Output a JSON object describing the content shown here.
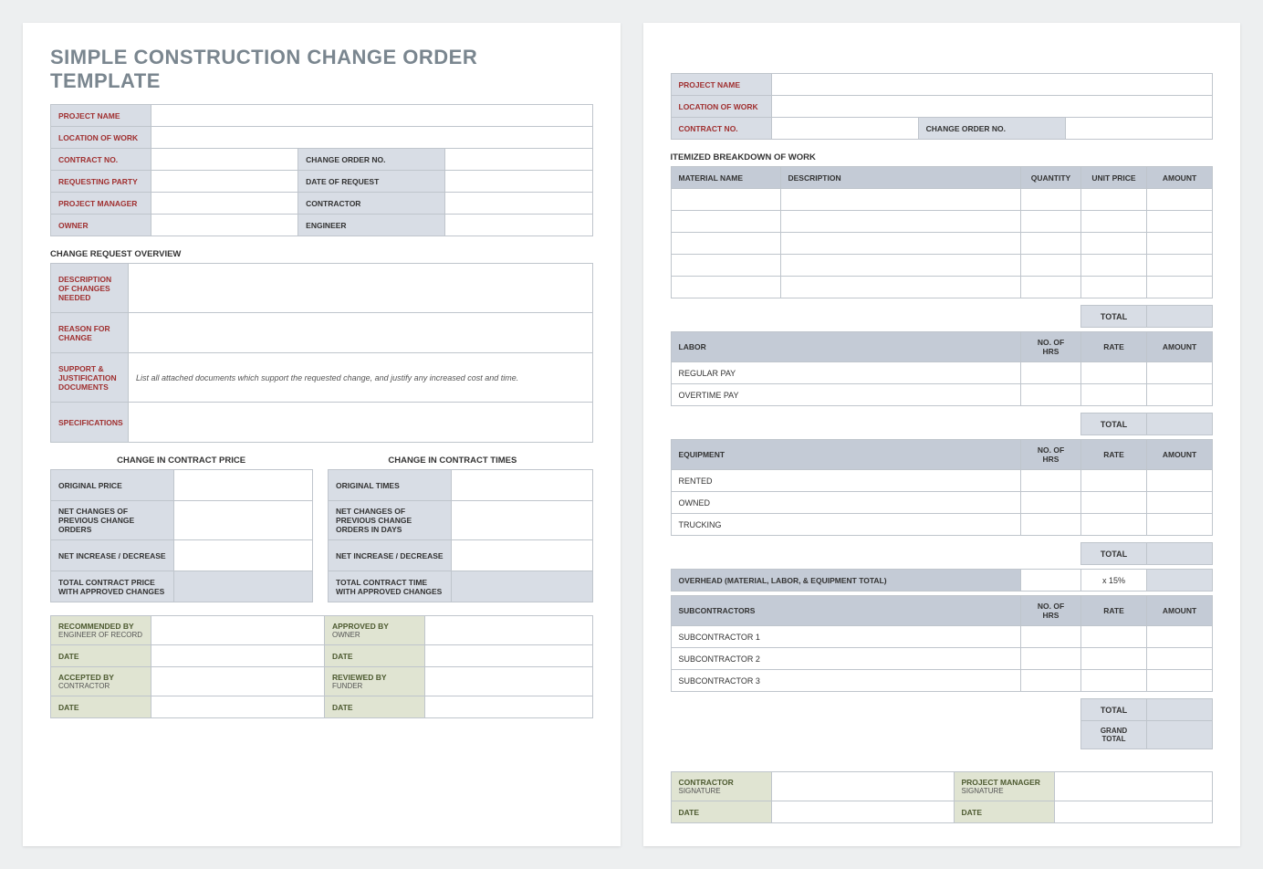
{
  "title": "SIMPLE CONSTRUCTION CHANGE ORDER TEMPLATE",
  "hdr": {
    "project_name": "PROJECT NAME",
    "location": "LOCATION OF WORK",
    "contract_no": "CONTRACT NO.",
    "change_order_no": "CHANGE ORDER NO.",
    "requesting_party": "REQUESTING PARTY",
    "date_of_request": "DATE OF REQUEST",
    "project_manager": "PROJECT MANAGER",
    "contractor": "CONTRACTOR",
    "owner": "OWNER",
    "engineer": "ENGINEER"
  },
  "overview": {
    "heading": "CHANGE REQUEST OVERVIEW",
    "desc": "DESCRIPTION OF CHANGES NEEDED",
    "reason": "REASON FOR CHANGE",
    "support": "SUPPORT & JUSTIFICATION DOCUMENTS",
    "support_note": "List all attached documents which support the requested change, and justify any increased cost and time.",
    "specs": "SPECIFICATIONS"
  },
  "price_title": "CHANGE IN CONTRACT PRICE",
  "times_title": "CHANGE IN CONTRACT TIMES",
  "price": {
    "original": "ORIGINAL PRICE",
    "net_prev": "NET CHANGES OF PREVIOUS CHANGE ORDERS",
    "net_inc": "NET INCREASE / DECREASE",
    "total": "TOTAL CONTRACT PRICE WITH APPROVED CHANGES"
  },
  "times": {
    "original": "ORIGINAL TIMES",
    "net_prev": "NET CHANGES OF PREVIOUS CHANGE ORDERS IN DAYS",
    "net_inc": "NET INCREASE / DECREASE",
    "total": "TOTAL CONTRACT TIME WITH APPROVED CHANGES"
  },
  "approvals": {
    "rec_by": "RECOMMENDED BY",
    "rec_sub": "ENGINEER OF RECORD",
    "app_by": "APPROVED BY",
    "app_sub": "OWNER",
    "acc_by": "ACCEPTED BY",
    "acc_sub": "CONTRACTOR",
    "rev_by": "REVIEWED BY",
    "rev_sub": "FUNDER",
    "date": "DATE"
  },
  "p2": {
    "project_name": "PROJECT NAME",
    "location": "LOCATION OF WORK",
    "contract_no": "CONTRACT NO.",
    "change_order_no": "CHANGE ORDER NO.",
    "itemized": "ITEMIZED BREAKDOWN OF WORK",
    "material_name": "MATERIAL NAME",
    "description": "DESCRIPTION",
    "quantity": "QUANTITY",
    "unit_price": "UNIT PRICE",
    "amount": "AMOUNT",
    "total": "TOTAL",
    "labor": "LABOR",
    "hrs": "NO. OF HRS",
    "rate": "RATE",
    "regular": "REGULAR PAY",
    "overtime": "OVERTIME PAY",
    "equipment": "EQUIPMENT",
    "rented": "RENTED",
    "owned": "OWNED",
    "trucking": "TRUCKING",
    "overhead": "OVERHEAD (MATERIAL, LABOR, & EQUIPMENT TOTAL)",
    "pct": "x 15%",
    "subs": "SUBCONTRACTORS",
    "sub1": "SUBCONTRACTOR 1",
    "sub2": "SUBCONTRACTOR 2",
    "sub3": "SUBCONTRACTOR 3",
    "grand": "GRAND TOTAL",
    "csig": "CONTRACTOR",
    "csig_sub": "SIGNATURE",
    "pmsig": "PROJECT MANAGER",
    "pmsig_sub": "SIGNATURE",
    "date": "DATE"
  }
}
